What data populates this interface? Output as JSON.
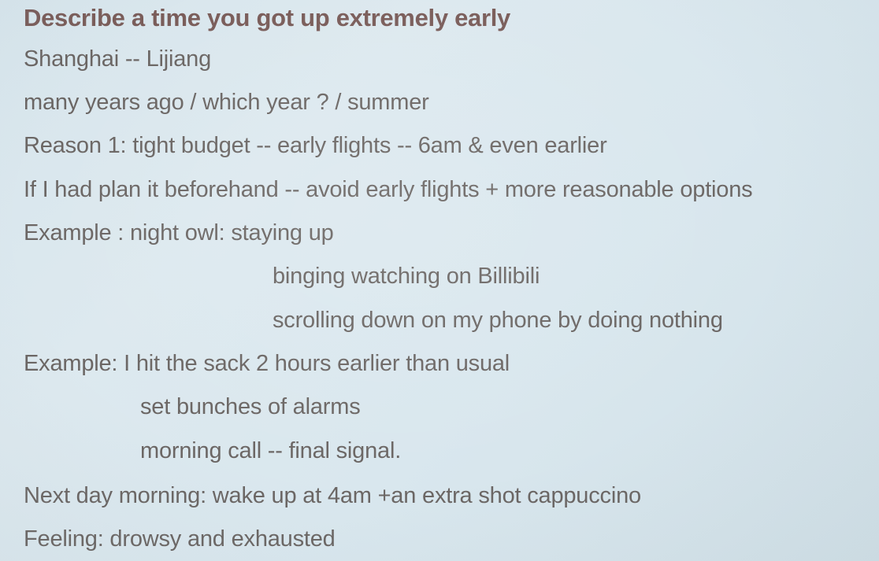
{
  "slide": {
    "title": "Describe a time you got up extremely early",
    "lines": [
      "Shanghai -- Lijiang",
      "many years ago / which year ? / summer",
      "Reason 1:  tight budget -- early flights -- 6am & even earlier",
      "If I had plan it beforehand -- avoid early flights + more reasonable options",
      "Example :  night owl: staying up",
      "binging watching on Billibili",
      "scrolling down on my phone by doing nothing",
      "Example:  I hit the sack 2 hours earlier than usual",
      "set bunches of alarms",
      "morning call -- final signal.",
      "Next day morning:  wake up at 4am +an extra shot cappuccino",
      "Feeling: drowsy and exhausted"
    ]
  }
}
